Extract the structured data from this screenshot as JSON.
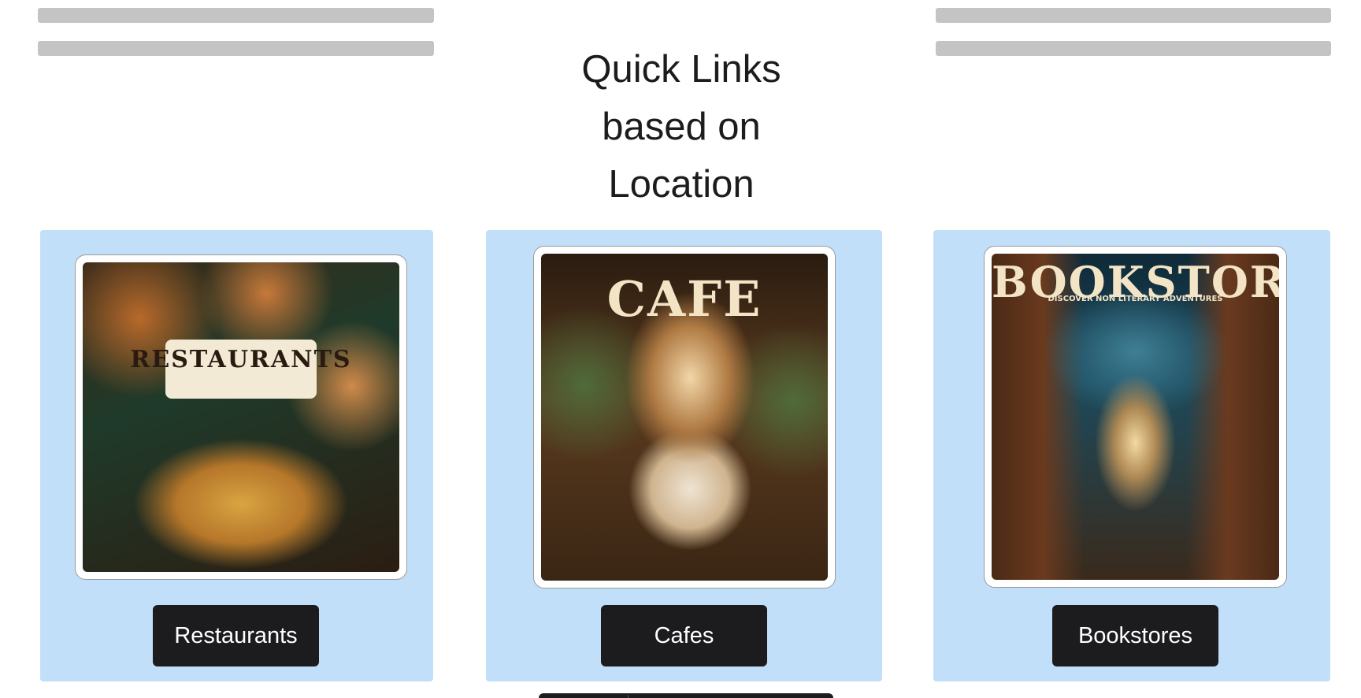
{
  "title": {
    "line1": "Quick Links",
    "line2": "based on",
    "line3": "Location"
  },
  "cards": [
    {
      "label": "Restaurants",
      "poster_text": "RESTAURANTS",
      "icon": "restaurants-poster"
    },
    {
      "label": "Cafes",
      "poster_text": "CAFE",
      "icon": "cafe-poster"
    },
    {
      "label": "Bookstores",
      "poster_text": "BOOKSTORES",
      "poster_subtext": "DISCOVER NON LITERARY ADVENTURES",
      "icon": "bookstores-poster"
    }
  ],
  "colors": {
    "card_background": "#c2dffa",
    "button_background": "#1c1c1e",
    "button_text": "#ffffff",
    "skeleton": "#c4c4c4"
  }
}
